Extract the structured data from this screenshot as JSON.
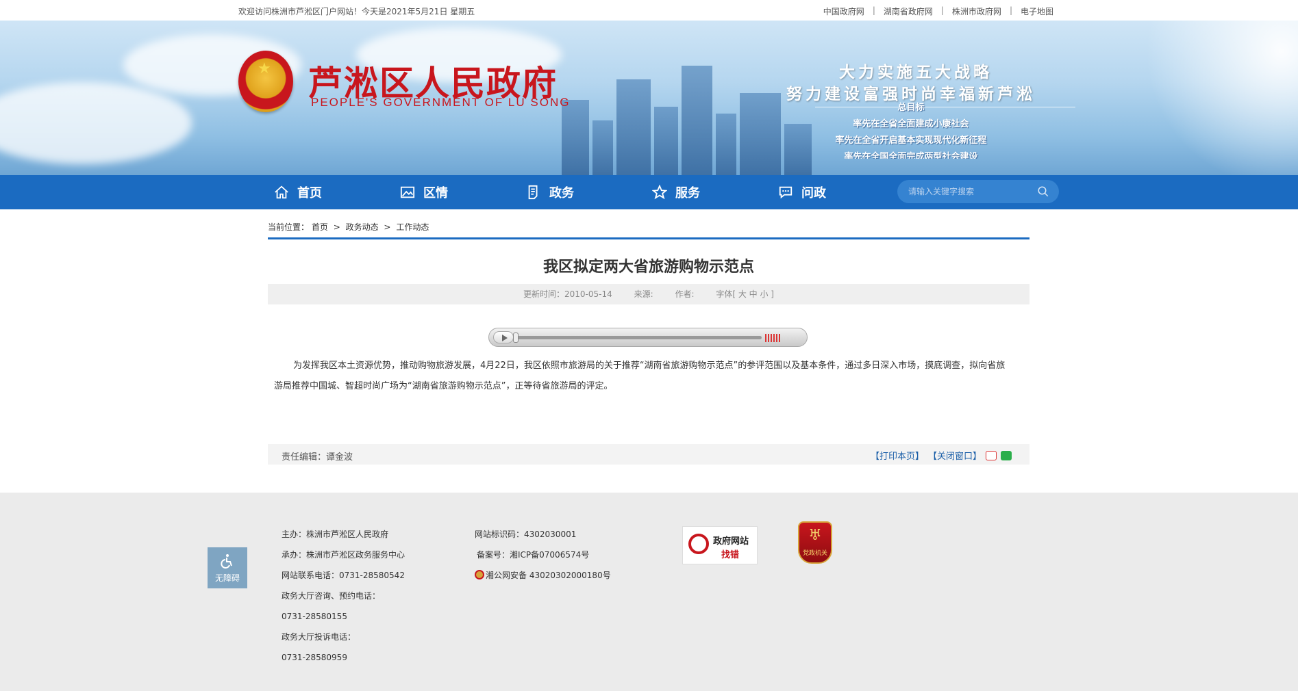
{
  "topbar": {
    "welcome": "欢迎访问株洲市芦淞区门户网站！今天是2021年5月21日 星期五",
    "links": [
      "中国政府网",
      "湖南省政府网",
      "株洲市政府网",
      "电子地图"
    ]
  },
  "banner": {
    "title": "芦淞区人民政府",
    "subtitle": "PEOPLE'S GOVERNMENT OF  LU SONG",
    "slogan_line1": "大力实施五大战略",
    "slogan_line2": "努力建设富强时尚幸福新芦淞",
    "goals": [
      "总目标",
      "率先在全省全面建成小康社会",
      "率先在全省开启基本实现现代化新征程",
      "率先在全国全面完成两型社会建设"
    ]
  },
  "nav": {
    "items": [
      "首页",
      "区情",
      "政务",
      "服务",
      "问政"
    ],
    "search_placeholder": "请输入关键字搜索"
  },
  "breadcrumb": {
    "prefix": "当前位置：",
    "items": [
      "首页",
      "政务动态",
      "工作动态"
    ]
  },
  "article": {
    "title": "我区拟定两大省旅游购物示范点",
    "update_time": "更新时间：2010-05-14",
    "source": "来源:",
    "author": "作者:",
    "font_size": "字体[ 大 中 小 ]",
    "body": "为发挥我区本土资源优势，推动购物旅游发展，4月22日，我区依照市旅游局的关于推荐“湖南省旅游购物示范点”的参评范围以及基本条件，通过多日深入市场，摸底调查，拟向省旅游局推荐中国城、智超时尚广场为“湖南省旅游购物示范点”，正等待省旅游局的评定。",
    "editor": "责任编辑：谭金波",
    "print": "【打印本页】",
    "close": "【关闭窗口】"
  },
  "footer": {
    "accessibility": "无障碍",
    "col1": [
      "主办：株洲市芦淞区人民政府",
      "承办：株洲市芦淞区政务服务中心",
      "网站联系电话：0731-28580542",
      "政务大厅咨询、预约电话：",
      "0731-28580155",
      "政务大厅投诉电话：",
      "0731-28580959"
    ],
    "site_code": "网站标识码：4302030001",
    "icp": "备案号：湘ICP备07006574号",
    "police": "湘公网安备 43020302000180号",
    "find_error_l1": "政府网站",
    "find_error_l2": "找错",
    "party_badge": "党政机关"
  }
}
